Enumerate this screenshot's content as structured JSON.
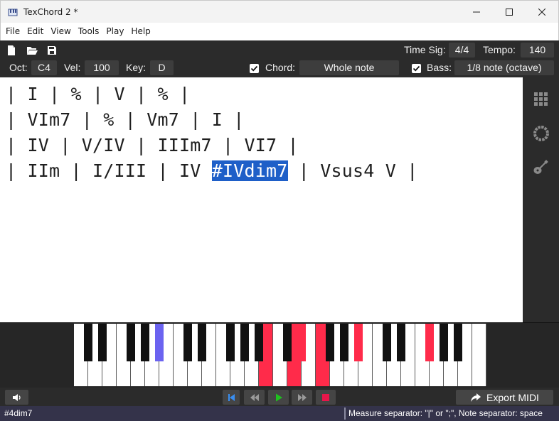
{
  "window": {
    "title": "TexChord 2 *"
  },
  "menu": [
    "File",
    "Edit",
    "View",
    "Tools",
    "Play",
    "Help"
  ],
  "toolbar": {
    "time_sig_label": "Time Sig:",
    "time_sig_value": "4/4",
    "tempo_label": "Tempo:",
    "tempo_value": "140",
    "oct_label": "Oct:",
    "oct_value": "C4",
    "vel_label": "Vel:",
    "vel_value": "100",
    "key_label": "Key:",
    "key_value": "D",
    "chord_label": "Chord:",
    "chord_checked": true,
    "chord_value": "Whole note",
    "bass_label": "Bass:",
    "bass_checked": true,
    "bass_value": "1/8 note (octave)"
  },
  "editor": {
    "lines": [
      "| I | % | V | % |",
      "| VIm7 | % | Vm7 | I |",
      "| IV | V/IV | IIIm7 | VI7 |"
    ],
    "line4_before": "| IIm | I/III | IV ",
    "line4_selected": "#IVdim7",
    "line4_after": " | Vsus4 V |"
  },
  "side_panel": {
    "icons": [
      "grid-icon",
      "circle-of-fifths-icon",
      "guitar-icon"
    ]
  },
  "piano": {
    "white_key_count": 29,
    "pressed_color": "#ff2b4a",
    "cursor_color": "#6b63f0"
  },
  "transport": {
    "export_label": "Export MIDI",
    "play_color": "#1fc01f",
    "stop_color": "#e8164a",
    "start_color": "#3a8ef0"
  },
  "status": {
    "left": "#4dim7",
    "right": "Measure separator: \"|\" or \";\", Note separator: space"
  }
}
